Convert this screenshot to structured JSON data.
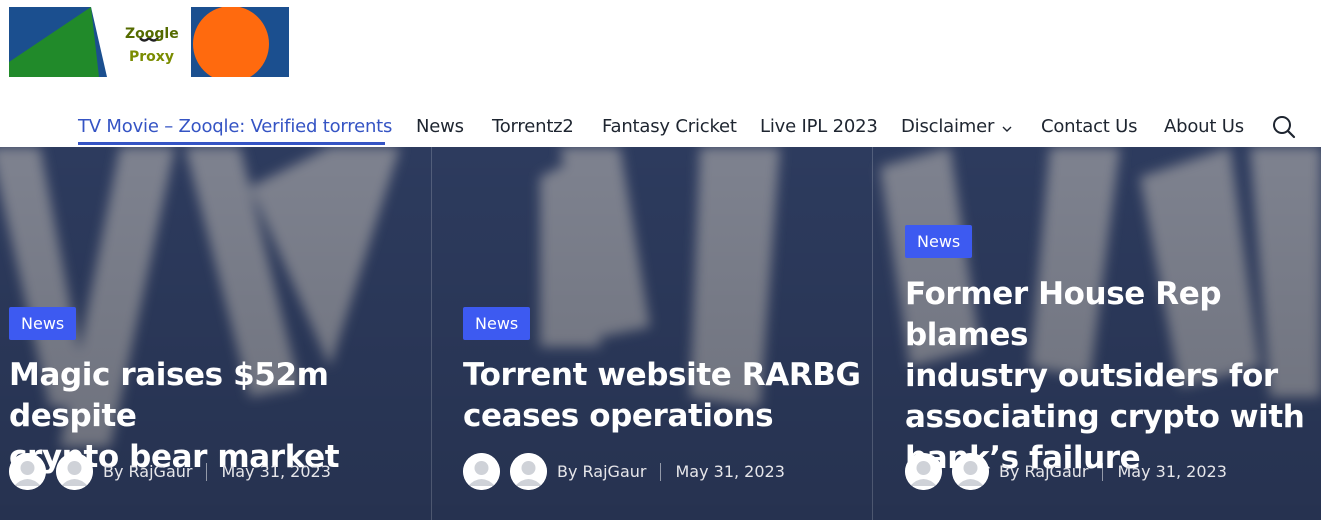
{
  "logo": {
    "line1": "Zoogle",
    "line2": "Proxy",
    "colors": {
      "bg": "#1b4f8f",
      "triangle": "#218a2a",
      "circle": "#ff6a0e",
      "panel": "#ffffff"
    }
  },
  "nav": {
    "items": [
      {
        "label": "TV Movie – Zooqle: Verified torrents",
        "active": true
      },
      {
        "label": "News"
      },
      {
        "label": "Torrentz2"
      },
      {
        "label": "Fantasy Cricket"
      },
      {
        "label": "Live IPL 2023"
      },
      {
        "label": "Disclaimer",
        "has_dropdown": true,
        "icon": "chevron-down-icon"
      },
      {
        "label": "Contact Us"
      },
      {
        "label": "About Us"
      }
    ],
    "search_icon": "search-icon",
    "accent": "#3554c4"
  },
  "hero": {
    "cards": [
      {
        "badge": "News",
        "title_lines": [
          "Magic raises $52m despite",
          "crypto bear market"
        ],
        "author": "By RajGaur",
        "date": "May 31, 2023"
      },
      {
        "badge": "News",
        "title_lines": [
          "Torrent website RARBG",
          "ceases operations"
        ],
        "author": "By RajGaur",
        "date": "May 31, 2023"
      },
      {
        "badge": "News",
        "title_lines": [
          "Former House Rep blames",
          "industry outsiders for",
          "associating crypto with",
          "bank’s failure"
        ],
        "author": "By RajGaur",
        "date": "May 31, 2023"
      }
    ],
    "badge_color": "#3d5af1"
  }
}
